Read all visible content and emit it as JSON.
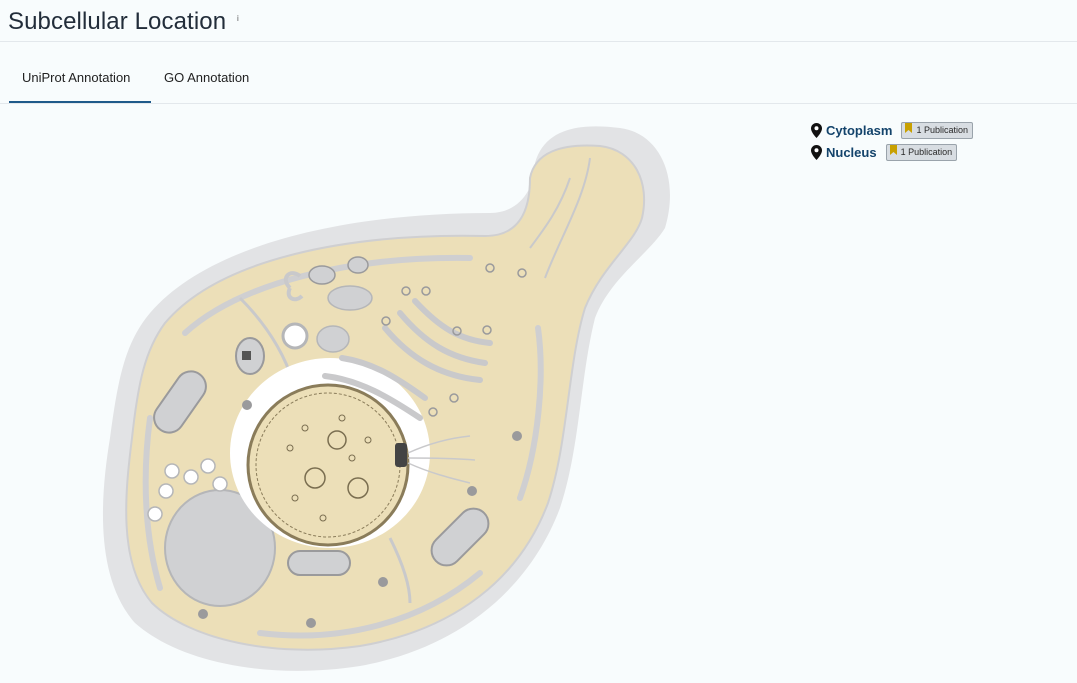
{
  "header": {
    "title": "Subcellular Location",
    "info_mark": "i"
  },
  "tabs": [
    {
      "label": "UniProt Annotation",
      "active": true
    },
    {
      "label": "GO Annotation",
      "active": false
    }
  ],
  "locations": [
    {
      "name": "Cytoplasm",
      "publications": "1 Publication"
    },
    {
      "name": "Nucleus",
      "publications": "1 Publication"
    }
  ],
  "colors": {
    "accent": "#1f5a8a",
    "cytoplasm": "#ecdfb8",
    "membrane": "#e3e3e5",
    "organelle": "#d0d1d3",
    "bookmark": "#c8a000"
  },
  "icons": [
    "map-pin-icon",
    "bookmark-icon",
    "info-icon"
  ]
}
